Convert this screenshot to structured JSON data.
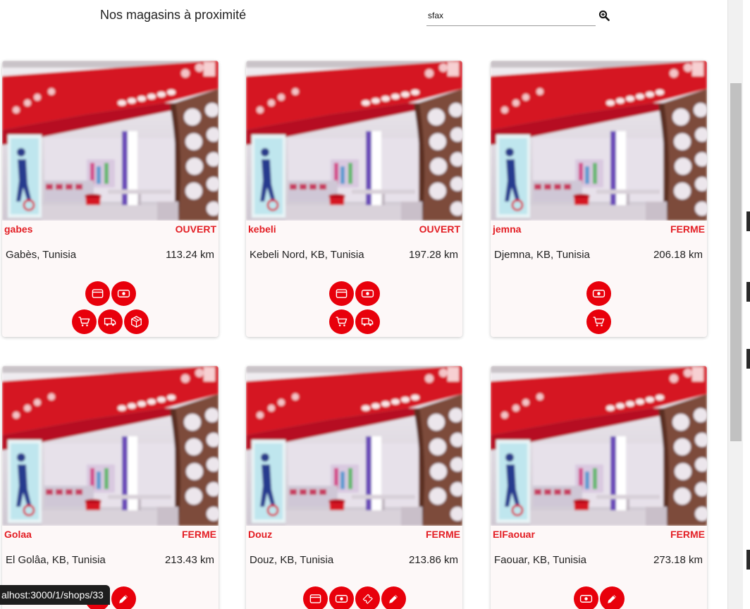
{
  "header": {
    "title": "Nos magasins à proximité",
    "search_value": "sfax",
    "search_icon": "zoom-in-icon"
  },
  "colors": {
    "accent": "#e8000b",
    "name_text": "#e31e24",
    "card_bg": "#fdf8f8"
  },
  "shops": [
    {
      "name": "gabes",
      "status": "OUVERT",
      "address": "Gabès, Tunisia",
      "distance": "113.24 km",
      "services": [
        [
          "card-icon",
          "cash-icon"
        ],
        [
          "cart-icon",
          "truck-icon",
          "box-icon"
        ]
      ]
    },
    {
      "name": "kebeli",
      "status": "OUVERT",
      "address": "Kebeli Nord, KB, Tunisia",
      "distance": "197.28 km",
      "services": [
        [
          "card-icon",
          "cash-icon"
        ],
        [
          "cart-icon",
          "truck-icon"
        ]
      ]
    },
    {
      "name": "jemna",
      "status": "FERME",
      "address": "Djemna, KB, Tunisia",
      "distance": "206.18 km",
      "services": [
        [
          "cash-icon"
        ],
        [
          "cart-icon"
        ]
      ]
    },
    {
      "name": "Golaa",
      "status": "FERME",
      "address": "El Golâa, KB, Tunisia",
      "distance": "213.43 km",
      "services": [
        [
          "ticket-icon",
          "pencil-icon"
        ]
      ]
    },
    {
      "name": "Douz",
      "status": "FERME",
      "address": "Douz, KB, Tunisia",
      "distance": "213.86 km",
      "services": [
        [
          "card-icon",
          "cash-icon",
          "ticket-icon",
          "pencil-icon"
        ]
      ]
    },
    {
      "name": "ElFaouar",
      "status": "FERME",
      "address": "Faouar, KB, Tunisia",
      "distance": "273.18 km",
      "services": [
        [
          "cash-icon",
          "pencil-icon"
        ]
      ]
    }
  ],
  "status_bar": {
    "url": "alhost:3000/1/shops/33"
  }
}
